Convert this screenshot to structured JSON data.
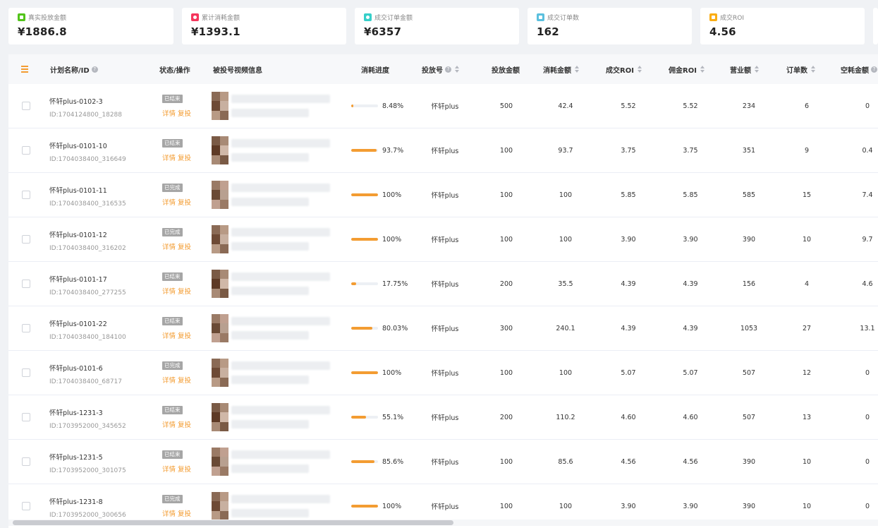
{
  "cards": [
    {
      "label": "真实投放金额",
      "value": "¥1886.8",
      "color": "#52c41a"
    },
    {
      "label": "累计消耗金额",
      "value": "¥1393.1",
      "color": "#f5365c"
    },
    {
      "label": "成交订单金额",
      "value": "¥6357",
      "color": "#36cfc9"
    },
    {
      "label": "成交订单数",
      "value": "162",
      "color": "#5bc0de"
    },
    {
      "label": "成交ROI",
      "value": "4.56",
      "color": "#faad14"
    }
  ],
  "table": {
    "headers": {
      "plan": "计划名称/ID",
      "status": "状态/操作",
      "video": "被投号视频信息",
      "progress": "消耗进度",
      "account": "投放号",
      "budget": "投放金额",
      "spent": "消耗金额",
      "roi": "成交ROI",
      "commission_roi": "佣金ROI",
      "revenue": "营业额",
      "orders": "订单数",
      "idle": "空耗金额"
    },
    "detail_label": "详情",
    "reinvest_label": "复投",
    "rows": [
      {
        "name": "怀轩plus-0102-3",
        "id": "ID:1704124800_18288",
        "status": "已结束",
        "progress": "8.48%",
        "progress_value": 0.0848,
        "account": "怀轩plus",
        "budget": "500",
        "spent": "42.4",
        "roi": "5.52",
        "commission_roi": "5.52",
        "revenue": "234",
        "orders": "6",
        "idle": "0"
      },
      {
        "name": "怀轩plus-0101-10",
        "id": "ID:1704038400_316649",
        "status": "已结束",
        "progress": "93.7%",
        "progress_value": 0.937,
        "account": "怀轩plus",
        "budget": "100",
        "spent": "93.7",
        "roi": "3.75",
        "commission_roi": "3.75",
        "revenue": "351",
        "orders": "9",
        "idle": "0.4"
      },
      {
        "name": "怀轩plus-0101-11",
        "id": "ID:1704038400_316535",
        "status": "已完成",
        "progress": "100%",
        "progress_value": 1.0,
        "account": "怀轩plus",
        "budget": "100",
        "spent": "100",
        "roi": "5.85",
        "commission_roi": "5.85",
        "revenue": "585",
        "orders": "15",
        "idle": "7.4"
      },
      {
        "name": "怀轩plus-0101-12",
        "id": "ID:1704038400_316202",
        "status": "已完成",
        "progress": "100%",
        "progress_value": 1.0,
        "account": "怀轩plus",
        "budget": "100",
        "spent": "100",
        "roi": "3.90",
        "commission_roi": "3.90",
        "revenue": "390",
        "orders": "10",
        "idle": "9.7"
      },
      {
        "name": "怀轩plus-0101-17",
        "id": "ID:1704038400_277255",
        "status": "已结束",
        "progress": "17.75%",
        "progress_value": 0.1775,
        "account": "怀轩plus",
        "budget": "200",
        "spent": "35.5",
        "roi": "4.39",
        "commission_roi": "4.39",
        "revenue": "156",
        "orders": "4",
        "idle": "4.6"
      },
      {
        "name": "怀轩plus-0101-22",
        "id": "ID:1704038400_184100",
        "status": "已结束",
        "progress": "80.03%",
        "progress_value": 0.8003,
        "account": "怀轩plus",
        "budget": "300",
        "spent": "240.1",
        "roi": "4.39",
        "commission_roi": "4.39",
        "revenue": "1053",
        "orders": "27",
        "idle": "13.1"
      },
      {
        "name": "怀轩plus-0101-6",
        "id": "ID:1704038400_68717",
        "status": "已完成",
        "progress": "100%",
        "progress_value": 1.0,
        "account": "怀轩plus",
        "budget": "100",
        "spent": "100",
        "roi": "5.07",
        "commission_roi": "5.07",
        "revenue": "507",
        "orders": "12",
        "idle": "0"
      },
      {
        "name": "怀轩plus-1231-3",
        "id": "ID:1703952000_345652",
        "status": "已结束",
        "progress": "55.1%",
        "progress_value": 0.551,
        "account": "怀轩plus",
        "budget": "200",
        "spent": "110.2",
        "roi": "4.60",
        "commission_roi": "4.60",
        "revenue": "507",
        "orders": "13",
        "idle": "0"
      },
      {
        "name": "怀轩plus-1231-5",
        "id": "ID:1703952000_301075",
        "status": "已结束",
        "progress": "85.6%",
        "progress_value": 0.856,
        "account": "怀轩plus",
        "budget": "100",
        "spent": "85.6",
        "roi": "4.56",
        "commission_roi": "4.56",
        "revenue": "390",
        "orders": "10",
        "idle": "0"
      },
      {
        "name": "怀轩plus-1231-8",
        "id": "ID:1703952000_300656",
        "status": "已完成",
        "progress": "100%",
        "progress_value": 1.0,
        "account": "怀轩plus",
        "budget": "100",
        "spent": "100",
        "roi": "3.90",
        "commission_roi": "3.90",
        "revenue": "390",
        "orders": "10",
        "idle": "0"
      }
    ]
  }
}
